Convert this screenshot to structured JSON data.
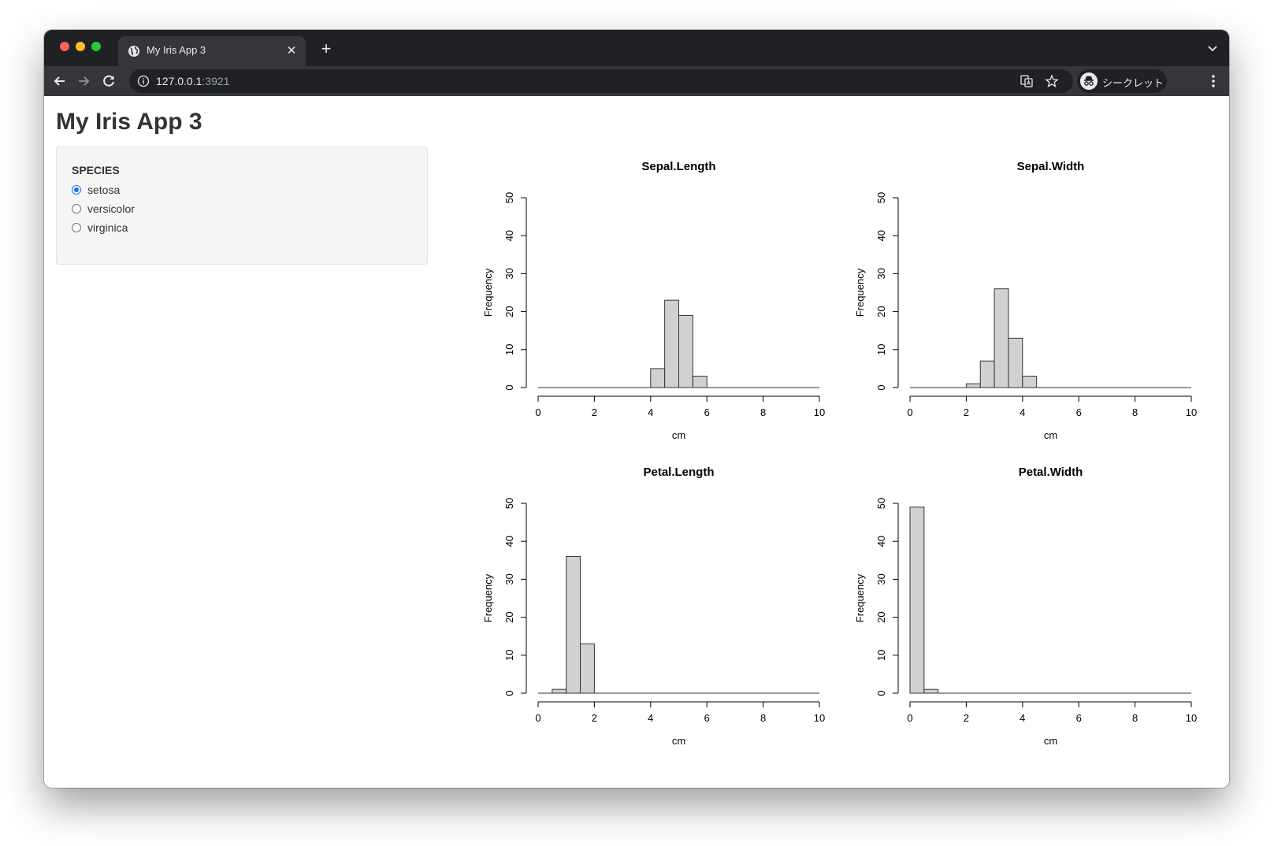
{
  "browser": {
    "tab_title": "My Iris App 3",
    "url_host": "127.0.0.1",
    "url_port": ":3921",
    "profile_label": "シークレット",
    "new_tab_label": "+",
    "close_label": "✕"
  },
  "page": {
    "title": "My Iris App 3"
  },
  "sidebar": {
    "label": "SPECIES",
    "options": [
      "setosa",
      "versicolor",
      "virginica"
    ],
    "selected": "setosa"
  },
  "colors": {
    "bar_fill": "#d1d1d1",
    "bar_stroke": "#333333",
    "radio_accent": "#1a73e8"
  },
  "chart_data": [
    {
      "type": "bar",
      "title": "Sepal.Length",
      "xlabel": "cm",
      "ylabel": "Frequency",
      "xlim": [
        0,
        10
      ],
      "ylim": [
        0,
        50
      ],
      "xticks": [
        0,
        2,
        4,
        6,
        8,
        10
      ],
      "yticks": [
        0,
        10,
        20,
        30,
        40,
        50
      ],
      "bin_width": 0.5,
      "bins": [
        4.0,
        4.5,
        5.0,
        5.5
      ],
      "values": [
        5,
        23,
        19,
        3
      ]
    },
    {
      "type": "bar",
      "title": "Sepal.Width",
      "xlabel": "cm",
      "ylabel": "Frequency",
      "xlim": [
        0,
        10
      ],
      "ylim": [
        0,
        50
      ],
      "xticks": [
        0,
        2,
        4,
        6,
        8,
        10
      ],
      "yticks": [
        0,
        10,
        20,
        30,
        40,
        50
      ],
      "bin_width": 0.5,
      "bins": [
        2.0,
        2.5,
        3.0,
        3.5,
        4.0
      ],
      "values": [
        1,
        7,
        26,
        13,
        3
      ]
    },
    {
      "type": "bar",
      "title": "Petal.Length",
      "xlabel": "cm",
      "ylabel": "Frequency",
      "xlim": [
        0,
        10
      ],
      "ylim": [
        0,
        50
      ],
      "xticks": [
        0,
        2,
        4,
        6,
        8,
        10
      ],
      "yticks": [
        0,
        10,
        20,
        30,
        40,
        50
      ],
      "bin_width": 0.5,
      "bins": [
        0.5,
        1.0,
        1.5
      ],
      "values": [
        1,
        36,
        13
      ]
    },
    {
      "type": "bar",
      "title": "Petal.Width",
      "xlabel": "cm",
      "ylabel": "Frequency",
      "xlim": [
        0,
        10
      ],
      "ylim": [
        0,
        50
      ],
      "xticks": [
        0,
        2,
        4,
        6,
        8,
        10
      ],
      "yticks": [
        0,
        10,
        20,
        30,
        40,
        50
      ],
      "bin_width": 0.5,
      "bins": [
        0.0,
        0.5
      ],
      "values": [
        49,
        1
      ]
    }
  ]
}
